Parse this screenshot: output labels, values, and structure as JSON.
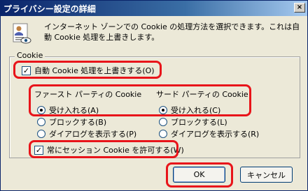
{
  "window": {
    "title": "プライバシー設定の詳細",
    "close_label": "×"
  },
  "description": "インターネット ゾーンでの Cookie の処理方法を選択できます。これは自動 Cookie 処理を上書きします。",
  "group": {
    "label": "Cookie",
    "override_auto": {
      "label": "自動 Cookie 処理を上書きする(O)",
      "checked": true
    },
    "first_party": {
      "heading": "ファースト パーティの Cookie",
      "options": [
        "受け入れる(A)",
        "ブロックする(B)",
        "ダイアログを表示する(P)"
      ],
      "selected": 0
    },
    "third_party": {
      "heading": "サード パーティの Cookie",
      "options": [
        "受け入れる(C)",
        "ブロックする(L)",
        "ダイアログを表示する(R)"
      ],
      "selected": 0
    },
    "session_cookies": {
      "label": "常にセッション Cookie を許可する(W)",
      "checked": true
    }
  },
  "buttons": {
    "ok": "OK",
    "cancel": "キャンセル"
  },
  "colors": {
    "highlight": "#e8141a",
    "titlebar": "#0a246a"
  }
}
